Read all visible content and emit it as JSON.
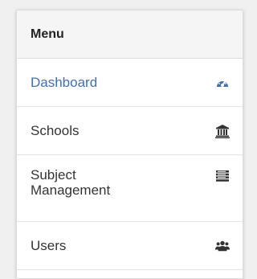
{
  "menu": {
    "header": "Menu",
    "items": [
      {
        "label": "Dashboard",
        "icon": "dashboard-icon",
        "active": true
      },
      {
        "label": "Schools",
        "icon": "institution-icon",
        "active": false
      },
      {
        "label": "Subject\nManagement",
        "icon": "list-icon",
        "active": false
      },
      {
        "label": "Users",
        "icon": "users-icon",
        "active": false
      }
    ]
  },
  "colors": {
    "accent": "#3f6fb5",
    "icon": "#333333"
  }
}
